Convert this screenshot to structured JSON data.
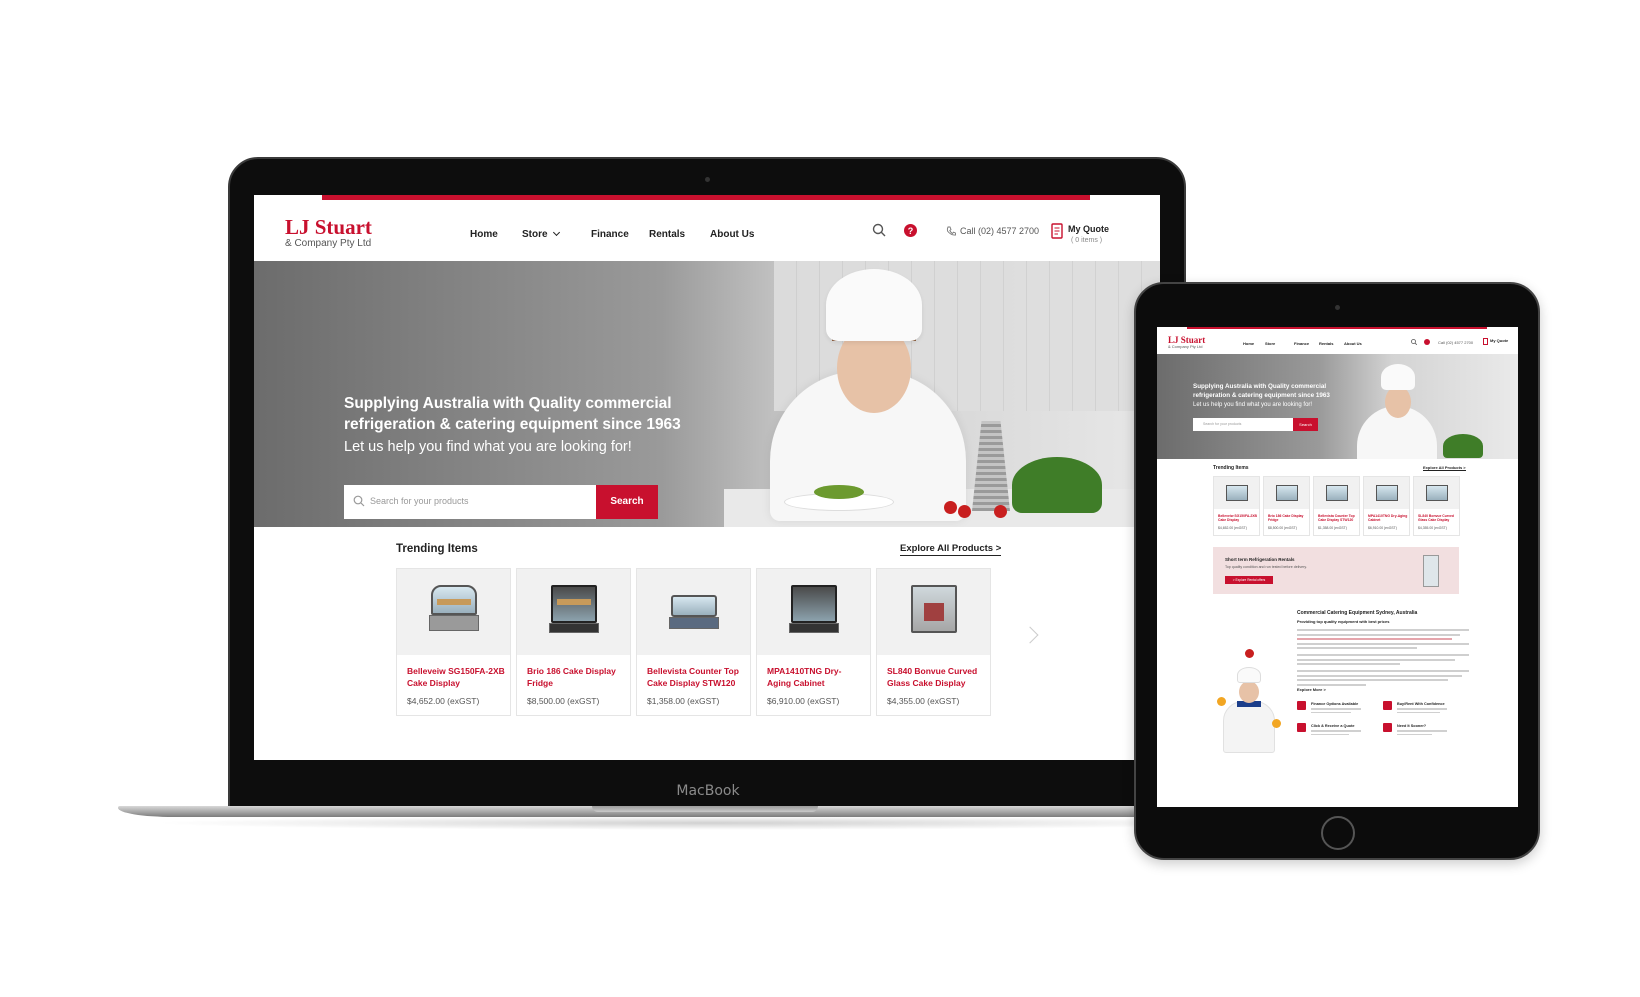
{
  "device_labels": {
    "laptop": "MacBook"
  },
  "colors": {
    "brand_red": "#c8102e",
    "text_dark": "#222222"
  },
  "laptop_site": {
    "logo": {
      "main": "LJ Stuart",
      "sub": "& Company Pty Ltd"
    },
    "nav": [
      {
        "label": "Home"
      },
      {
        "label": "Store",
        "icon": "chevron-down-icon"
      },
      {
        "label": "Finance"
      },
      {
        "label": "Rentals"
      },
      {
        "label": "About Us"
      }
    ],
    "header": {
      "phone": "Call (02) 4577 2700",
      "quote_label": "My Quote",
      "quote_count": "( 0 items )"
    },
    "hero": {
      "title": "Supplying Australia with Quality commercial refrigeration & catering equipment since 1963",
      "subtitle": "Let us help you find what you are looking for!",
      "search_placeholder": "Search for your products",
      "search_button": "Search"
    },
    "trending": {
      "title": "Trending Items",
      "explore_link": "Explore All Products >",
      "items": [
        {
          "name": "Belleveiw SG150FA-2XB Cake Display",
          "price": "$4,652.00 (exGST)"
        },
        {
          "name": "Brio 186 Cake Display Fridge",
          "price": "$8,500.00 (exGST)"
        },
        {
          "name": "Bellevista Counter Top Cake Display STW120",
          "price": "$1,358.00 (exGST)"
        },
        {
          "name": "MPA1410TNG Dry-Aging Cabinet",
          "price": "$6,910.00 (exGST)"
        },
        {
          "name": "SL840 Bonvue Curved Glass Cake Display",
          "price": "$4,355.00 (exGST)"
        }
      ]
    }
  },
  "tablet_site": {
    "logo": {
      "main": "LJ Stuart",
      "sub": "& Company Pty Ltd"
    },
    "nav": [
      "Home",
      "Store",
      "Finance",
      "Rentals",
      "About Us"
    ],
    "phone": "Call (02) 4577 2700",
    "quote_label": "My Quote",
    "hero": {
      "title": "Supplying Australia with Quality commercial refrigeration & catering equipment since 1963",
      "subtitle": "Let us help you find what you are looking for!",
      "search_placeholder": "Search for your products",
      "search_button": "Search"
    },
    "trending": {
      "title": "Trending Items",
      "explore_link": "Explore All Products >",
      "items": [
        {
          "name": "Belleveiw SG150FA-2XB Cake Display",
          "price": "$4,652.00 (exGST)"
        },
        {
          "name": "Brio 186 Cake Display Fridge",
          "price": "$8,500.00 (exGST)"
        },
        {
          "name": "Bellevista Counter Top Cake Display STW120",
          "price": "$1,358.00 (exGST)"
        },
        {
          "name": "MPA1410TNG Dry-Aging Cabinet",
          "price": "$6,910.00 (exGST)"
        },
        {
          "name": "SL840 Bonvue Curved Glass Cake Display",
          "price": "$4,355.00 (exGST)"
        }
      ]
    },
    "banner": {
      "title": "Short term Refrigeration Rentals",
      "subtitle": "Top quality condition and run tested before delivery.",
      "button": "> Explore Rental offers"
    },
    "about": {
      "title": "Commercial Catering Equipment Sydney, Australia",
      "subtitle": "Providing top quality equipment with best prices",
      "explore": "Explore More >"
    },
    "features": [
      {
        "label": "Finance Options Available"
      },
      {
        "label": "Buy/Rent With Confidence"
      },
      {
        "label": "Click & Receive a Quote"
      },
      {
        "label": "Need It Sooner?"
      }
    ]
  }
}
